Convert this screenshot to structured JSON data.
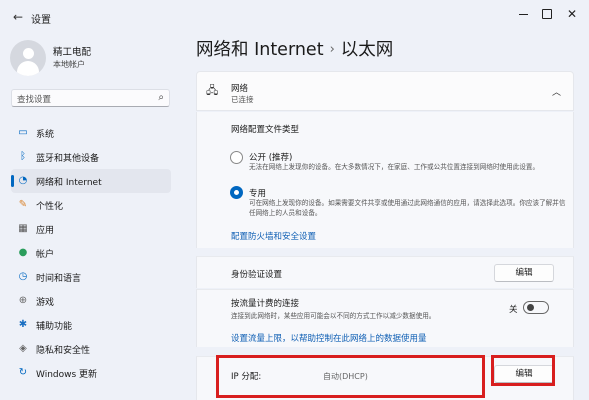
{
  "window": {
    "app_title": "设置",
    "back_icon": "back-arrow-icon",
    "close_glyph": "✕"
  },
  "profile": {
    "name": "精工电配",
    "account_type": "本地帐户"
  },
  "search": {
    "placeholder": "查找设置"
  },
  "sidebar": {
    "items": [
      {
        "label": "系统",
        "icon": "monitor-icon",
        "glyph": "▭",
        "color": "#0067c0"
      },
      {
        "label": "蓝牙和其他设备",
        "icon": "bluetooth-icon",
        "glyph": "ᛒ",
        "color": "#0067c0"
      },
      {
        "label": "网络和 Internet",
        "icon": "wifi-icon",
        "glyph": "◔",
        "color": "#0067c0",
        "selected": true
      },
      {
        "label": "个性化",
        "icon": "brush-icon",
        "glyph": "✎",
        "color": "#d9822b"
      },
      {
        "label": "应用",
        "icon": "apps-icon",
        "glyph": "▦",
        "color": "#555555"
      },
      {
        "label": "帐户",
        "icon": "person-icon",
        "glyph": "●",
        "color": "#2a9d5c"
      },
      {
        "label": "时间和语言",
        "icon": "globe-clock-icon",
        "glyph": "◷",
        "color": "#0067c0"
      },
      {
        "label": "游戏",
        "icon": "gamepad-icon",
        "glyph": "⊕",
        "color": "#666666"
      },
      {
        "label": "辅助功能",
        "icon": "accessibility-icon",
        "glyph": "✱",
        "color": "#1a6fc2"
      },
      {
        "label": "隐私和安全性",
        "icon": "shield-icon",
        "glyph": "◈",
        "color": "#666666"
      },
      {
        "label": "Windows 更新",
        "icon": "update-icon",
        "glyph": "↻",
        "color": "#0067c0"
      }
    ]
  },
  "breadcrumb": {
    "parent": "网络和 Internet",
    "separator": "›",
    "current": "以太网"
  },
  "network_panel": {
    "title": "网络",
    "status": "已连接",
    "icon": "ethernet-icon"
  },
  "profile_type": {
    "label": "网络配置文件类型",
    "options": [
      {
        "title": "公开 (推荐)",
        "desc": "无法在网络上发现你的设备。在大多数情况下，在家庭、工作或公共位置连接到网络时使用此设置。",
        "checked": false
      },
      {
        "title": "专用",
        "desc": "可在网络上发现你的设备。如果需要文件共享或使用通过此网络通信的应用，请选择此选项。你应该了解并信任网络上的人员和设备。",
        "checked": true
      }
    ],
    "firewall_link": "配置防火墙和安全设置"
  },
  "auth": {
    "label": "身份验证设置",
    "button": "编辑"
  },
  "metered": {
    "label": "按流量计费的连接",
    "desc": "连接到此网络时，某些应用可能会以不同的方式工作以减少数据使用。",
    "toggle_state": "关",
    "toggle_on": false,
    "link": "设置流量上限，以帮助控制在此网络上的数据使用量"
  },
  "ip": {
    "label": "IP 分配:",
    "value": "自动(DHCP)",
    "button": "编辑"
  },
  "colors": {
    "accent": "#0067c0",
    "highlight": "#d81e1e"
  }
}
